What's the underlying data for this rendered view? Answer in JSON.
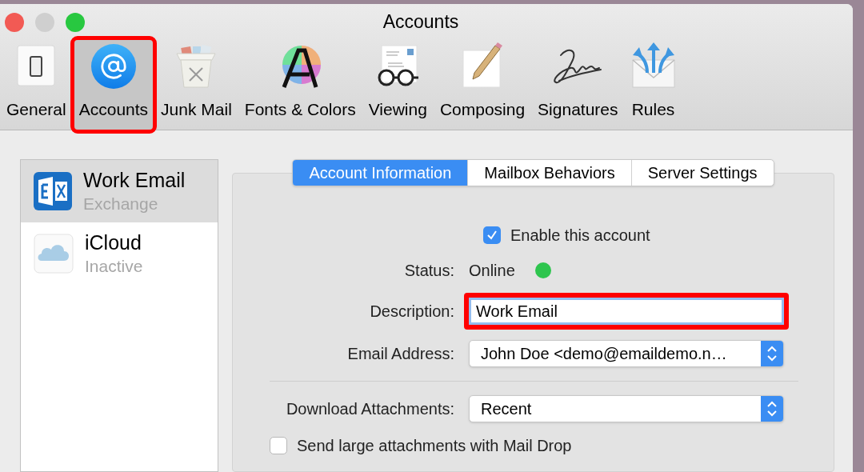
{
  "window": {
    "title": "Accounts"
  },
  "toolbar": [
    {
      "label": "General",
      "kind": "general",
      "selected": false,
      "highlighted": false
    },
    {
      "label": "Accounts",
      "kind": "accounts",
      "selected": true,
      "highlighted": true
    },
    {
      "label": "Junk Mail",
      "kind": "junk",
      "selected": false,
      "highlighted": false
    },
    {
      "label": "Fonts & Colors",
      "kind": "fonts",
      "selected": false,
      "highlighted": false
    },
    {
      "label": "Viewing",
      "kind": "viewing",
      "selected": false,
      "highlighted": false
    },
    {
      "label": "Composing",
      "kind": "composing",
      "selected": false,
      "highlighted": false
    },
    {
      "label": "Signatures",
      "kind": "signatures",
      "selected": false,
      "highlighted": false
    },
    {
      "label": "Rules",
      "kind": "rules",
      "selected": false,
      "highlighted": false
    }
  ],
  "accounts": [
    {
      "name": "Work Email",
      "detail": "Exchange",
      "kind": "exchange",
      "selected": true
    },
    {
      "name": "iCloud",
      "detail": "Inactive",
      "kind": "icloud",
      "selected": false
    }
  ],
  "tabs": [
    {
      "label": "Account Information",
      "selected": true
    },
    {
      "label": "Mailbox Behaviors",
      "selected": false
    },
    {
      "label": "Server Settings",
      "selected": false
    }
  ],
  "form": {
    "enable_account": {
      "label": "Enable this account",
      "checked": true
    },
    "status": {
      "label": "Status:",
      "value": "Online",
      "color": "#2ec54e"
    },
    "description": {
      "label": "Description:",
      "value": "Work Email",
      "highlighted": true
    },
    "email_address": {
      "label": "Email Address:",
      "value": "John Doe <demo@emaildemo.n…"
    },
    "download_attachments": {
      "label": "Download Attachments:",
      "value": "Recent"
    },
    "mail_drop": {
      "label": "Send large attachments with Mail Drop",
      "checked": false
    }
  }
}
